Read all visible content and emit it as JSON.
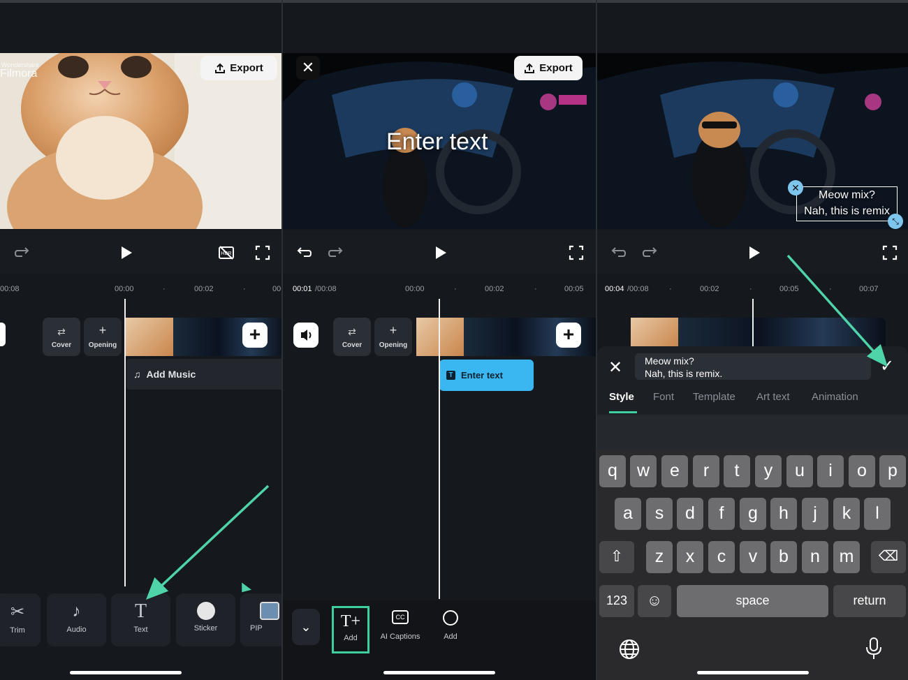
{
  "panel1": {
    "watermark_brand": "Wondershare",
    "watermark_product": "Filmora",
    "export_label": "Export",
    "times": [
      "00:08",
      "00:00",
      "00:02",
      "00"
    ],
    "cover_label": "Cover",
    "opening_label": "Opening",
    "add_music_label": "Add Music",
    "toolbar": [
      {
        "label": "Trim",
        "icon": "scissors-icon"
      },
      {
        "label": "Audio",
        "icon": "music-note-icon"
      },
      {
        "label": "Text",
        "icon": "text-icon"
      },
      {
        "label": "Sticker",
        "icon": "sticker-icon"
      },
      {
        "label": "PIP",
        "icon": "picture-icon"
      }
    ]
  },
  "panel2": {
    "export_label": "Export",
    "overlay_text": "Enter text",
    "time_current": "00:01",
    "time_total": "/00:08",
    "times": [
      "00:00",
      "00:02",
      "00:05"
    ],
    "cover_label": "Cover",
    "opening_label": "Opening",
    "text_clip_label": "Enter text",
    "toolbar": [
      {
        "label": "Add",
        "icon": "add-text-icon"
      },
      {
        "label": "AI Captions",
        "icon": "ai-captions-icon"
      },
      {
        "label": "Add",
        "icon": "add-sticker-icon"
      }
    ]
  },
  "panel3": {
    "overlay_line1": "Meow mix?",
    "overlay_line2": "Nah, this is remix",
    "time_current": "00:04",
    "time_total": "/00:08",
    "times": [
      "00:02",
      "00:05",
      "00:07"
    ],
    "input_line1": "Meow mix?",
    "input_line2": "Nah, this is remix.",
    "tabs": [
      "Style",
      "Font",
      "Template",
      "Art text",
      "Animation"
    ],
    "active_tab": "Style",
    "keyboard": {
      "row1": [
        "q",
        "w",
        "e",
        "r",
        "t",
        "y",
        "u",
        "i",
        "o",
        "p"
      ],
      "row2": [
        "a",
        "s",
        "d",
        "f",
        "g",
        "h",
        "j",
        "k",
        "l"
      ],
      "row3": [
        "z",
        "x",
        "c",
        "v",
        "b",
        "n",
        "m"
      ],
      "numbers_key": "123",
      "space_key": "space",
      "return_key": "return"
    }
  },
  "colors": {
    "accent": "#3ecf9f",
    "text_clip": "#3ab6f0",
    "arrow": "#4fd4a9"
  }
}
